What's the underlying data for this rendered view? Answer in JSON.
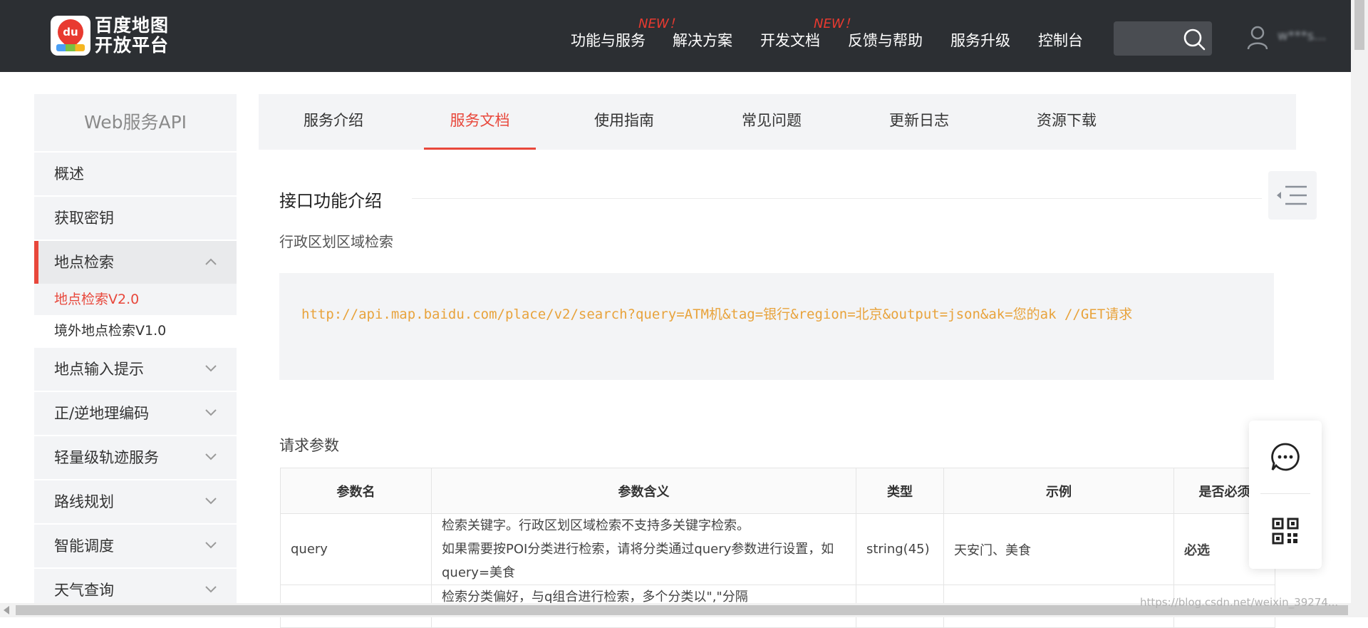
{
  "header": {
    "logo_text": "百度地图开放平台",
    "logo_badge": "du",
    "nav": [
      {
        "label": "功能与服务",
        "badge": "NEW！"
      },
      {
        "label": "解决方案",
        "badge": ""
      },
      {
        "label": "开发文档",
        "badge": "NEW！"
      },
      {
        "label": "反馈与帮助",
        "badge": ""
      },
      {
        "label": "服务升级",
        "badge": ""
      },
      {
        "label": "控制台",
        "badge": ""
      }
    ],
    "search_placeholder": "",
    "user_name": "w***s..."
  },
  "sidebar": {
    "title": "Web服务API",
    "items": [
      {
        "label": "概述"
      },
      {
        "label": "获取密钥"
      },
      {
        "label": "地点检索",
        "expanded": true
      },
      {
        "label": "地点输入提示"
      },
      {
        "label": "正/逆地理编码"
      },
      {
        "label": "轻量级轨迹服务"
      },
      {
        "label": "路线规划"
      },
      {
        "label": "智能调度"
      },
      {
        "label": "天气查询"
      }
    ],
    "sub_items": [
      {
        "label": "地点检索V2.0",
        "selected": true
      },
      {
        "label": "境外地点检索V1.0",
        "selected": false
      }
    ]
  },
  "tabs": [
    {
      "label": "服务介绍"
    },
    {
      "label": "服务文档",
      "active": true
    },
    {
      "label": "使用指南"
    },
    {
      "label": "常见问题"
    },
    {
      "label": "更新日志"
    },
    {
      "label": "资源下载"
    }
  ],
  "content": {
    "section_title": "接口功能介绍",
    "subtitle": "行政区划区域检索",
    "code_sample": "http://api.map.baidu.com/place/v2/search?query=ATM机&tag=银行&region=北京&output=json&ak=您的ak //GET请求",
    "params_title": "请求参数",
    "table": {
      "headers": [
        "参数名",
        "参数含义",
        "类型",
        "示例",
        "是否必须"
      ],
      "rows": [
        {
          "name": "query",
          "desc": [
            "检索关键字。行政区划区域检索不支持多关键字检索。",
            "如果需要按POI分类进行检索，请将分类通过query参数进行设置，如query=美食"
          ],
          "type": "string(45)",
          "example": "天安门、美食",
          "required": "必选"
        },
        {
          "name": "",
          "desc": [
            "检索分类偏好，与q组合进行检索，多个分类以\",\"分隔"
          ],
          "type": "",
          "example": "",
          "required": ""
        }
      ]
    }
  },
  "footer_watermark": "https://blog.csdn.net/weixin_39274..."
}
